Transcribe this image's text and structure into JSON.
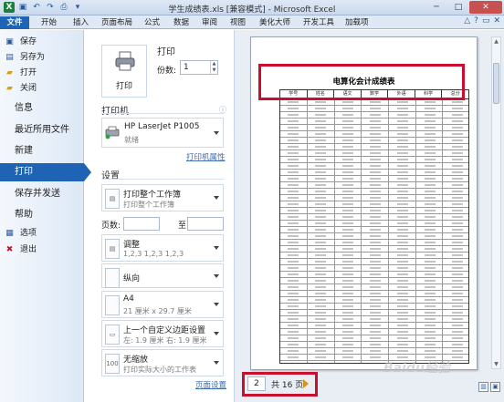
{
  "window": {
    "title": "学生成绩表.xls [兼容模式] - Microsoft Excel",
    "qat_icons": [
      "excel-app-icon",
      "save-icon",
      "undo-icon",
      "redo-icon",
      "print-preview-icon",
      "quick-access-dropdown-icon"
    ],
    "controls": {
      "minimize": "─",
      "maximize": "□",
      "close": "✕"
    }
  },
  "tabs": [
    "文件",
    "开始",
    "插入",
    "页面布局",
    "公式",
    "数据",
    "审阅",
    "视图",
    "美化大师",
    "开发工具",
    "加载项"
  ],
  "nav": {
    "items": [
      {
        "label": "保存",
        "type": "small",
        "icon": "save-icon"
      },
      {
        "label": "另存为",
        "type": "small",
        "icon": "save-as-icon"
      },
      {
        "label": "打开",
        "type": "small",
        "icon": "open-folder-icon"
      },
      {
        "label": "关闭",
        "type": "small",
        "icon": "close-folder-icon"
      },
      {
        "label": "信息",
        "type": "big"
      },
      {
        "label": "最近所用文件",
        "type": "big"
      },
      {
        "label": "新建",
        "type": "big"
      },
      {
        "label": "打印",
        "type": "big",
        "active": true
      },
      {
        "label": "保存并发送",
        "type": "big"
      },
      {
        "label": "帮助",
        "type": "big"
      },
      {
        "label": "选项",
        "type": "small",
        "icon": "options-icon"
      },
      {
        "label": "退出",
        "type": "small",
        "icon": "exit-icon"
      }
    ]
  },
  "print": {
    "heading": "打印",
    "button_label": "打印",
    "copies_label": "份数:",
    "copies_value": "1",
    "printer_heading": "打印机",
    "printer_name": "HP LaserJet P1005",
    "printer_status": "就绪",
    "printer_props_link": "打印机属性",
    "settings_heading": "设置",
    "scope_l1": "打印整个工作簿",
    "scope_l2": "打印整个工作簿",
    "pages_label": "页数:",
    "pages_to": "至",
    "collate_l1": "调整",
    "collate_l2": "1,2,3    1,2,3    1,2,3",
    "orientation_l1": "纵向",
    "paper_l1": "A4",
    "paper_l2": "21 厘米 x 29.7 厘米",
    "margins_l1": "上一个自定义边距设置",
    "margins_l2": "左: 1.9 厘米  右: 1.9 厘米",
    "scaling_l1": "无缩放",
    "scaling_l2": "打印实际大小的工作表",
    "page_setup_link": "页面设置"
  },
  "preview": {
    "sheet_title": "电算化会计成绩表",
    "headers": [
      "学号",
      "姓名",
      "语文",
      "数学",
      "外语",
      "科学",
      "总分"
    ],
    "page_current": "2",
    "page_total_text": "共 16 页",
    "watermark": "Baidu经验"
  }
}
